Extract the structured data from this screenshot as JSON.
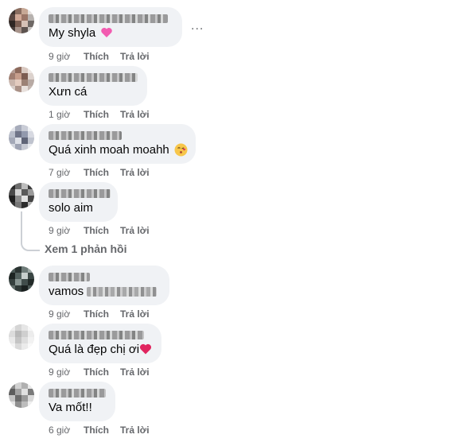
{
  "comments": [
    {
      "text": "My shyla",
      "emoji": "pink-heart",
      "time": "9 giờ",
      "like": "Thích",
      "reply": "Trả lời"
    },
    {
      "text": "Xưn cá",
      "time": "1 giờ",
      "like": "Thích",
      "reply": "Trả lời"
    },
    {
      "text": "Quá xinh moah moahh",
      "emoji": "kiss-face",
      "time": "7 giờ",
      "like": "Thích",
      "reply": "Trả lời"
    },
    {
      "text": "solo aim",
      "time": "9 giờ",
      "like": "Thích",
      "reply": "Trả lời"
    },
    {
      "text": "vamos",
      "time": "9 giờ",
      "like": "Thích",
      "reply": "Trả lời"
    },
    {
      "text": "Quá là đẹp chị ơi",
      "emoji": "red-heart",
      "time": "9 giờ",
      "like": "Thích",
      "reply": "Trả lời"
    },
    {
      "text": "Va mốt!!",
      "time": "6 giờ",
      "like": "Thích",
      "reply": "Trả lời"
    }
  ],
  "view_replies": "Xem 1 phản hồi",
  "more_menu": "...",
  "colors": {
    "bubble": "#f0f2f5",
    "meta": "#65676b",
    "heart_red": "#e0245e",
    "heart_pink": "#f25bb0"
  }
}
